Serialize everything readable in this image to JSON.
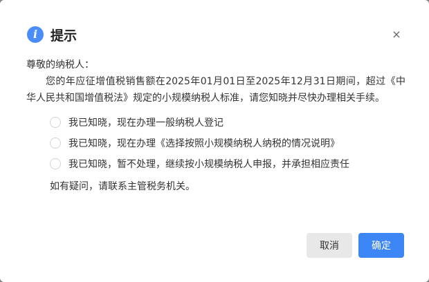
{
  "dialog": {
    "title": "提示",
    "close_glyph": "×",
    "info_glyph": "i",
    "greeting": "尊敬的纳税人：",
    "paragraph": "您的年应征增值税销售额在2025年01月01日至2025年12月31日期间，超过《中华人民共和国增值税法》规定的小规模纳税人标准，请您知晓并尽快办理相关手续。",
    "options": [
      {
        "label": "我已知晓，现在办理一般纳税人登记"
      },
      {
        "label": "我已知晓，现在办理《选择按照小规模纳税人纳税的情况说明》"
      },
      {
        "label": "我已知晓，暂不处理，继续按小规模纳税人申报，并承担相应责任"
      }
    ],
    "footnote": "如有疑问，请联系主管税务机关。",
    "cancel_label": "取消",
    "ok_label": "确定"
  },
  "colors": {
    "accent": "#3d86f5",
    "info_icon": "#4a8df8",
    "cancel_bg": "#e8e8e8"
  }
}
